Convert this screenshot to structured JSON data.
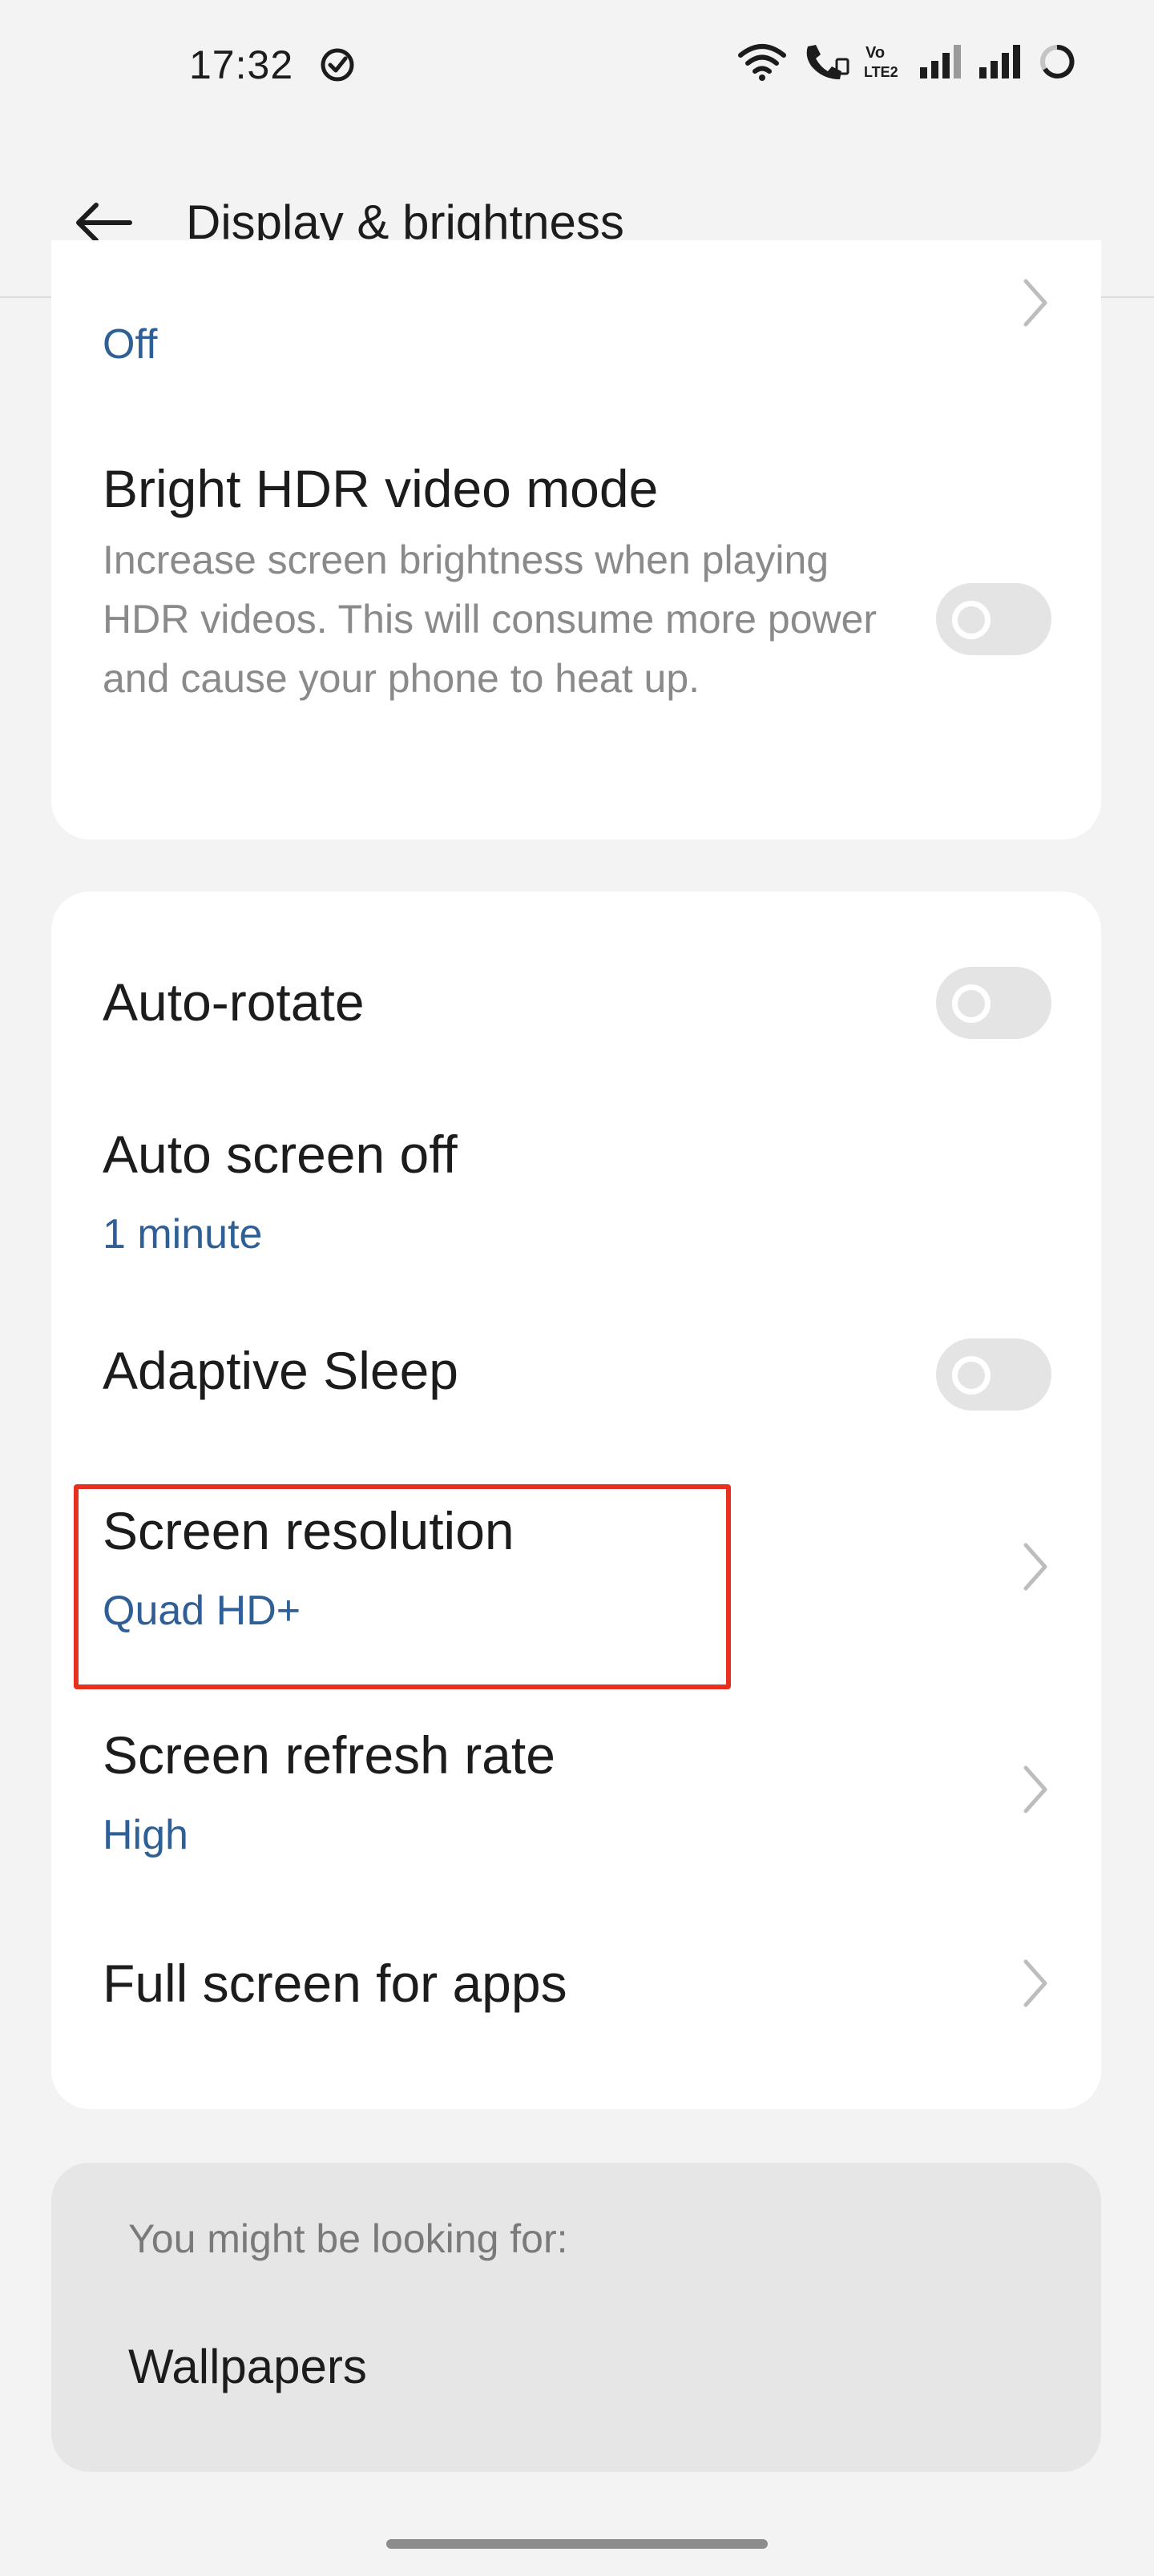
{
  "status_bar": {
    "time": "17:32",
    "volte_label": "Vo LTE2",
    "icons": [
      "check-circle-icon",
      "wifi-icon",
      "wifi-call-icon",
      "volte-icon",
      "signal-icon-1",
      "signal-icon-2",
      "battery-ring-icon"
    ]
  },
  "header": {
    "title": "Display & brightness",
    "back_icon": "arrow-left-icon"
  },
  "card1": {
    "partial_item_value": "Off",
    "hdr": {
      "title": "Bright HDR video mode",
      "description": "Increase screen brightness when playing HDR videos. This will consume more power and cause your phone to heat up.",
      "enabled": false
    }
  },
  "card2": {
    "auto_rotate": {
      "title": "Auto-rotate",
      "enabled": false
    },
    "auto_screen_off": {
      "title": "Auto screen off",
      "value": "1 minute"
    },
    "adaptive_sleep": {
      "title": "Adaptive Sleep",
      "enabled": false
    },
    "screen_resolution": {
      "title": "Screen resolution",
      "value": "Quad HD+"
    },
    "refresh_rate": {
      "title": "Screen refresh rate",
      "value": "High"
    },
    "full_screen": {
      "title": "Full screen for apps"
    }
  },
  "suggestions": {
    "label": "You might be looking for:",
    "items": [
      "Wallpapers"
    ]
  },
  "colors": {
    "accent_value": "#2e5f97",
    "highlight": "#e7301e",
    "background": "#f3f3f3",
    "card": "#ffffff"
  }
}
